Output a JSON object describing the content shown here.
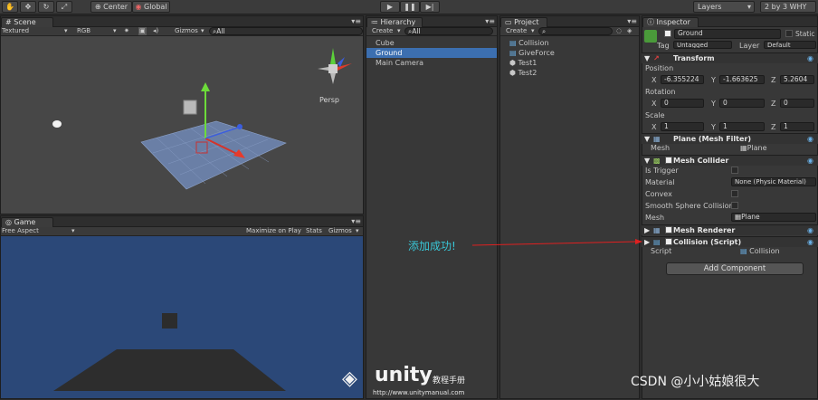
{
  "toolbar": {
    "pivot": "Center",
    "space": "Global",
    "layers": "Layers",
    "layout": "2 by 3 WHY"
  },
  "scene": {
    "tab": "Scene",
    "shading": "Textured",
    "render": "RGB",
    "gizmos": "Gizmos",
    "search": "All",
    "persp": "Persp"
  },
  "game": {
    "tab": "Game",
    "aspect": "Free Aspect",
    "maximize": "Maximize on Play",
    "stats": "Stats",
    "gizmos": "Gizmos"
  },
  "hierarchy": {
    "tab": "Hierarchy",
    "create": "Create",
    "search": "All",
    "items": [
      "Cube",
      "Ground",
      "Main Camera"
    ]
  },
  "project": {
    "tab": "Project",
    "create": "Create",
    "items": [
      "Collision",
      "GiveForce",
      "Test1",
      "Test2"
    ]
  },
  "inspector": {
    "tab": "Inspector",
    "name": "Ground",
    "static": "Static",
    "tag_label": "Tag",
    "tag": "Untagged",
    "layer_label": "Layer",
    "layer": "Default",
    "transform": "Transform",
    "position": "Position",
    "pos_x": "-6.355224",
    "pos_y": "-1.663625",
    "pos_z": "5.2604",
    "rotation": "Rotation",
    "rot_x": "0",
    "rot_y": "0",
    "rot_z": "0",
    "scale": "Scale",
    "scl_x": "1",
    "scl_y": "1",
    "scl_z": "1",
    "mesh_filter": "Plane (Mesh Filter)",
    "mesh_label": "Mesh",
    "mesh_value": "Plane",
    "mesh_collider": "Mesh Collider",
    "is_trigger": "Is Trigger",
    "material": "Material",
    "material_value": "None (Physic Material)",
    "convex": "Convex",
    "smooth": "Smooth Sphere Collisior",
    "mesh2": "Mesh",
    "mesh2_value": "Plane",
    "mesh_renderer": "Mesh Renderer",
    "collision": "Collision (Script)",
    "script_label": "Script",
    "script_value": "Collision",
    "add_component": "Add Component"
  },
  "annotation": "添加成功!",
  "watermark": {
    "brand": "unity",
    "sub": "教程手册",
    "url": "http://www.unitymanual.com"
  },
  "credit": "CSDN @小小姑娘很大",
  "colors": {
    "scene_bg": "#474747",
    "game_bg": "#2b4878",
    "selection": "#3c6fb0",
    "annotation": "#39c6d6"
  }
}
